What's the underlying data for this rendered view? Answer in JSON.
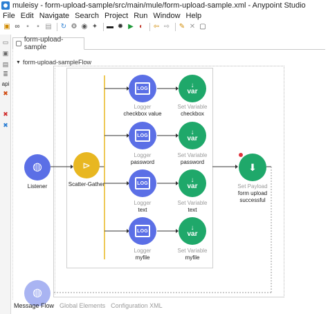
{
  "titlebar": {
    "title": "muleisy - form-upload-sample/src/main/mule/form-upload-sample.xml - Anypoint Studio"
  },
  "menubar": {
    "items": [
      "File",
      "Edit",
      "Navigate",
      "Search",
      "Project",
      "Run",
      "Window",
      "Help"
    ]
  },
  "toolbar": {
    "icons": [
      "new-icon",
      "link-icon",
      "save-icon",
      "save-all-icon",
      "print-icon",
      "refresh-icon",
      "gear-icon",
      "api-icon",
      "settings-icon",
      "deploy-icon",
      "debug-icon",
      "run-icon",
      "external-tools-icon",
      "back-icon",
      "forward-icon",
      "pin-icon",
      "close-icon",
      "window-icon"
    ]
  },
  "left_strip": {
    "api_label": "api"
  },
  "editor": {
    "tab_label": "form-upload-sample"
  },
  "flow": {
    "name": "form-upload-sampleFlow",
    "source": {
      "title": "Listener"
    },
    "router": {
      "title": "Scatter-Gather"
    },
    "routes": [
      {
        "logger_type": "Logger",
        "logger_name": "checkbox value",
        "setvar_type": "Set Variable",
        "setvar_name": "checkbox"
      },
      {
        "logger_type": "Logger",
        "logger_name": "password",
        "setvar_type": "Set Variable",
        "setvar_name": "password"
      },
      {
        "logger_type": "Logger",
        "logger_name": "text",
        "setvar_type": "Set Variable",
        "setvar_name": "text"
      },
      {
        "logger_type": "Logger",
        "logger_name": "myfile",
        "setvar_type": "Set Variable",
        "setvar_name": "myfile"
      }
    ],
    "payload": {
      "type": "Set Payload",
      "name_line1": "form upload",
      "name_line2": "successful"
    },
    "icon_text": {
      "logger": "LOG",
      "setvar": "var"
    }
  },
  "bottom_tabs": [
    "Message Flow",
    "Global Elements",
    "Configuration XML"
  ],
  "colors": {
    "logger": "#5b6fe6",
    "setvar": "#1fa86a",
    "scatter": "#e8b721",
    "error_dot": "#e0323c"
  }
}
